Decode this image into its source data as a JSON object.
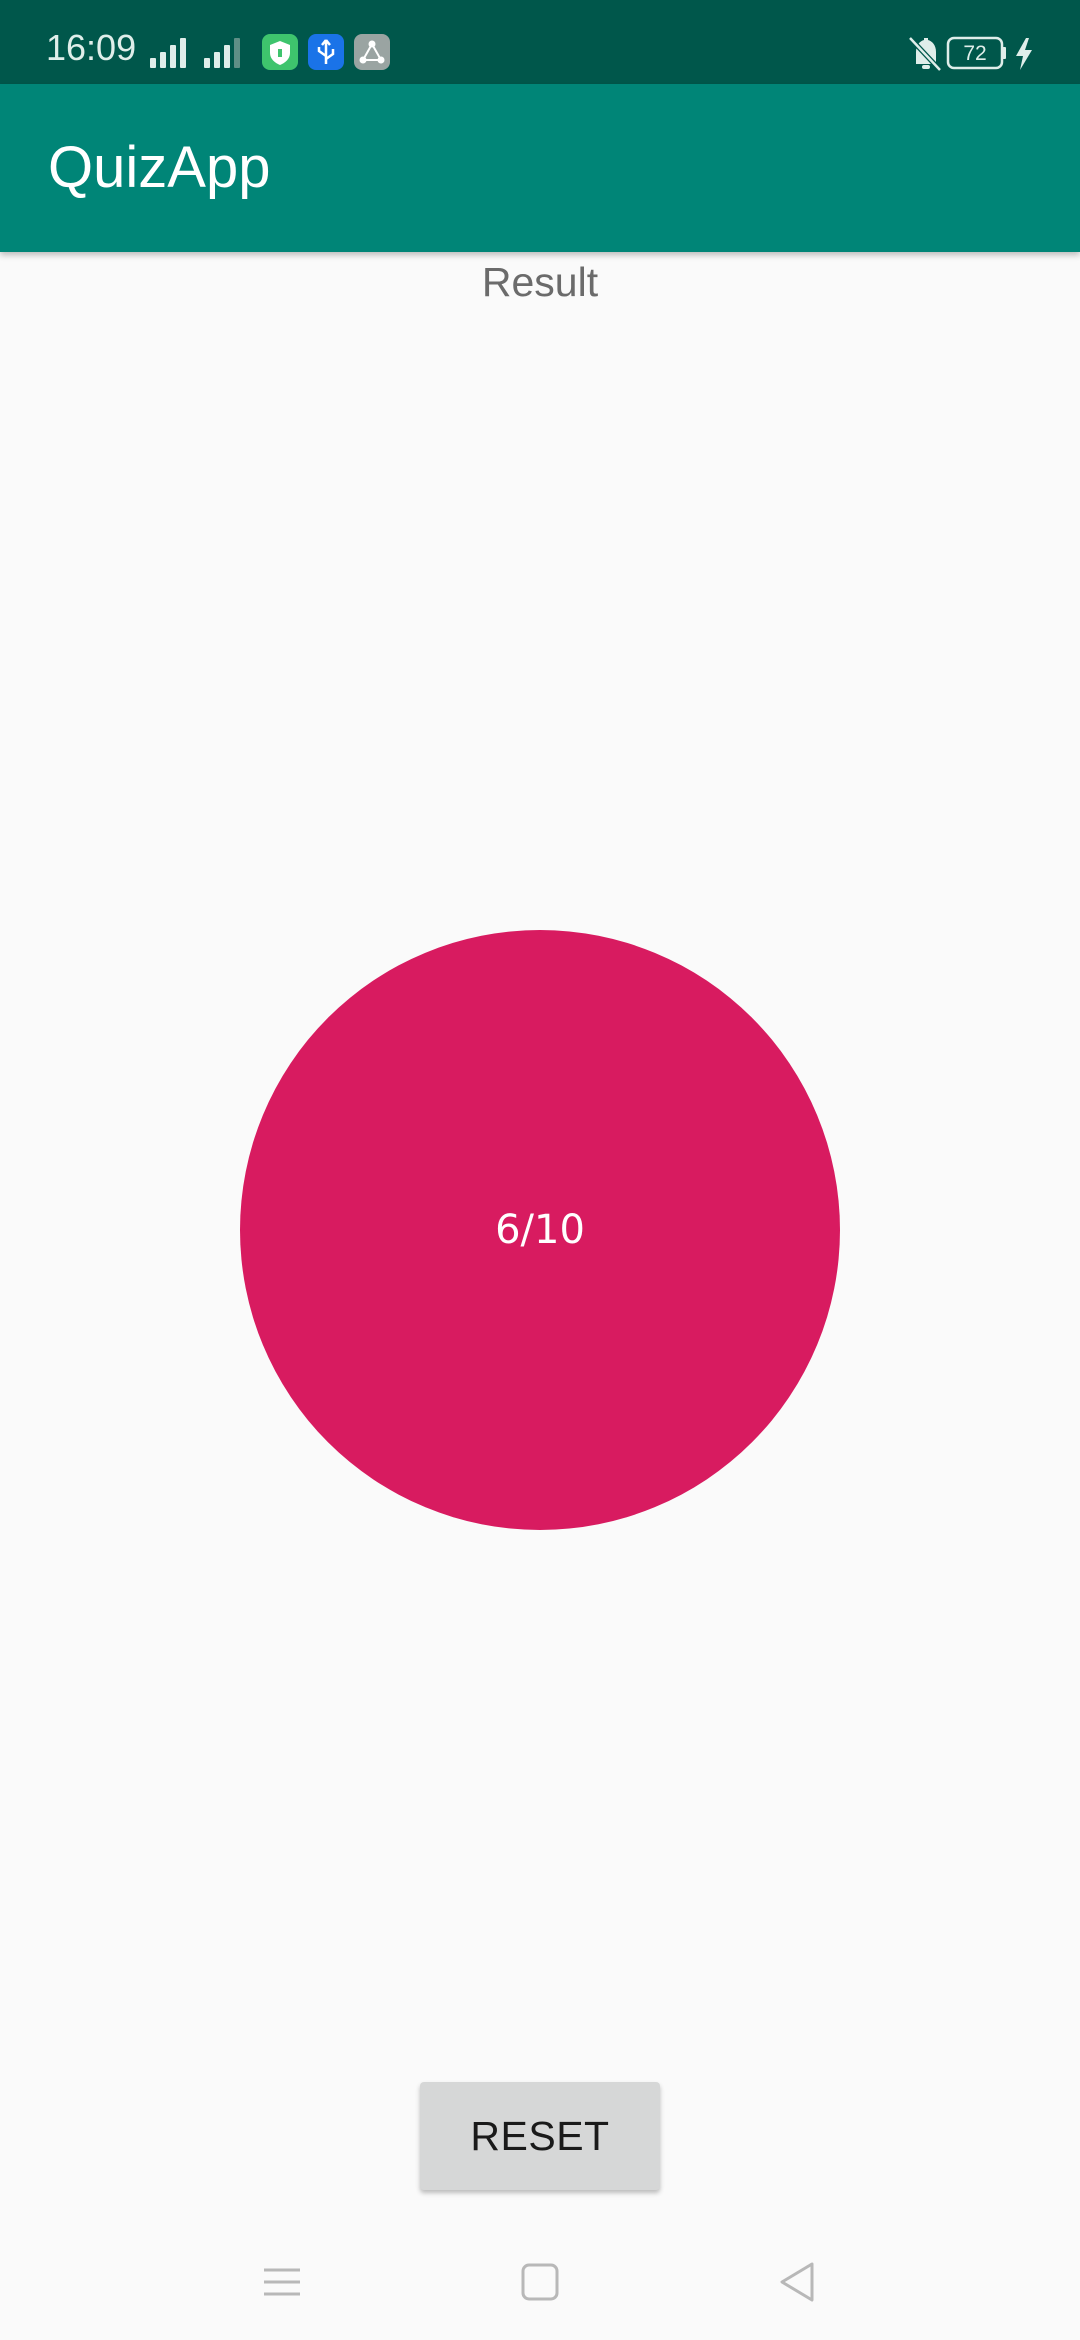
{
  "status_bar": {
    "time": "16:09",
    "battery_level": "72",
    "icons": [
      "signal-icon",
      "signal-icon",
      "shield-app-icon",
      "usb-icon",
      "network-share-icon",
      "notifications-off-icon",
      "battery-icon",
      "charging-icon"
    ]
  },
  "app_bar": {
    "title": "QuizApp",
    "color": "#008577"
  },
  "main": {
    "result_label": "Result",
    "score": "6/10",
    "score_circle_color": "#d81b60",
    "reset_label": "RESET"
  },
  "nav_bar": {
    "icons": [
      "menu-icon",
      "home-icon",
      "back-icon"
    ]
  }
}
